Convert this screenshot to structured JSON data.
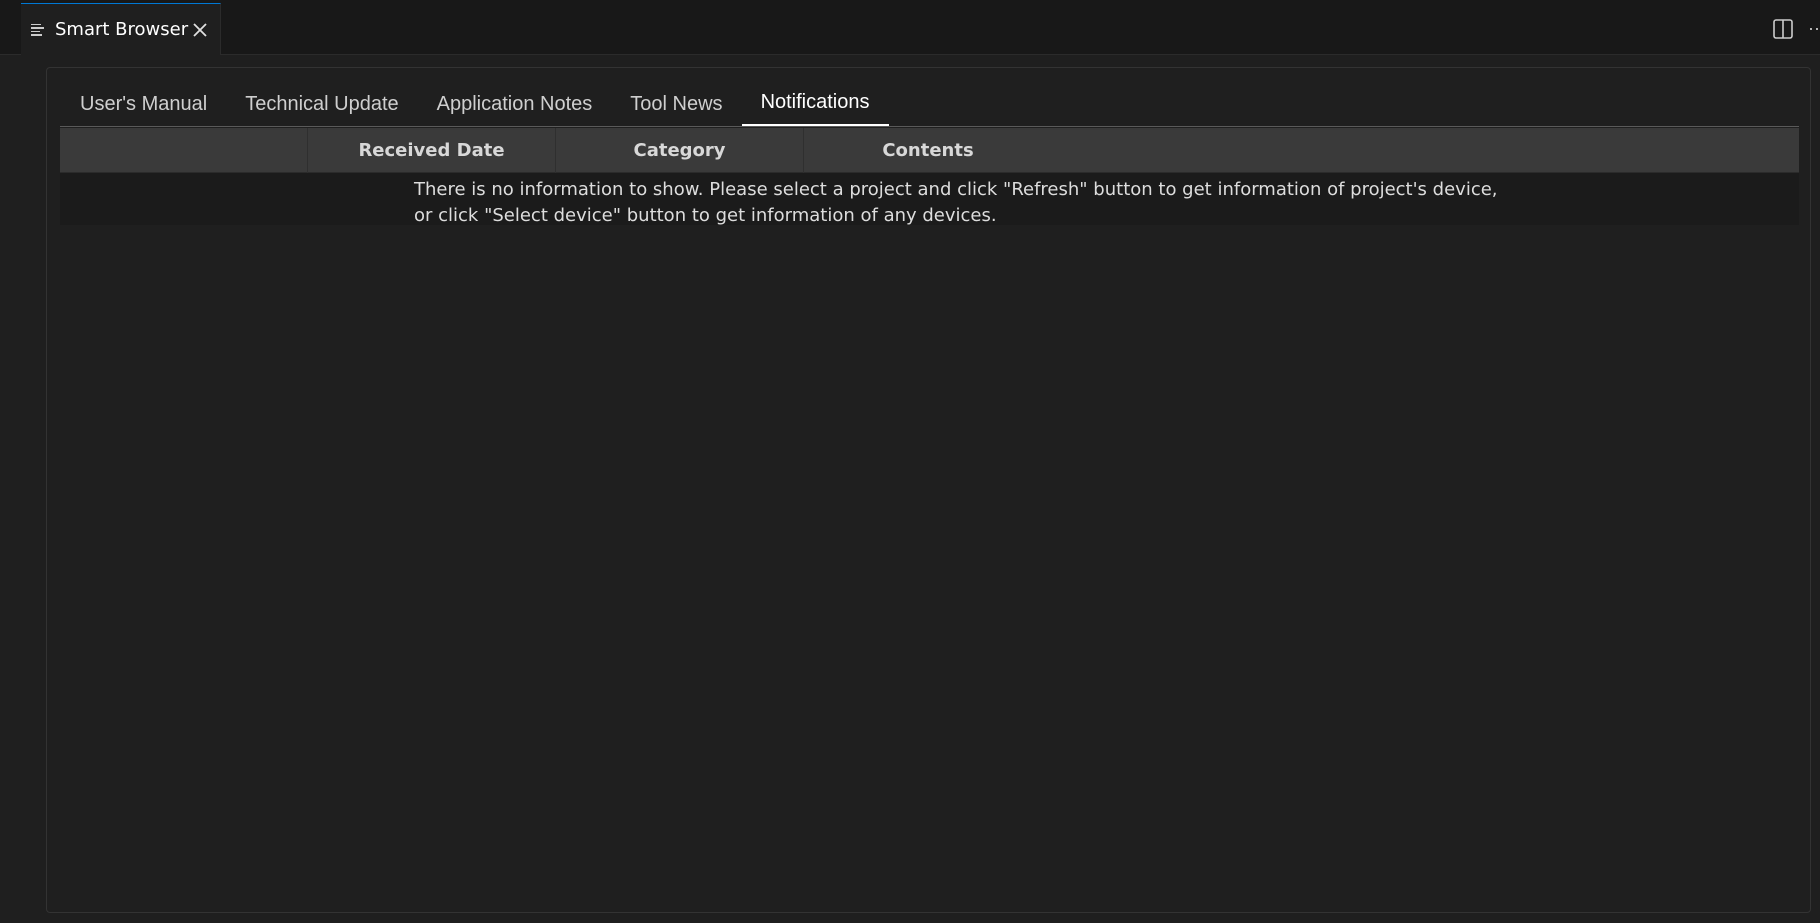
{
  "editor_tab": {
    "title": "Smart Browser",
    "icon": "list-icon",
    "close_icon": "close-icon"
  },
  "toolbar": {
    "split_icon": "split-editor-icon",
    "more_icon": "more-actions-icon"
  },
  "nav_tabs": [
    {
      "label": "User's Manual",
      "active": false
    },
    {
      "label": "Technical Update",
      "active": false
    },
    {
      "label": "Application Notes",
      "active": false
    },
    {
      "label": "Tool News",
      "active": false
    },
    {
      "label": "Notifications",
      "active": true
    }
  ],
  "table": {
    "columns": [
      "",
      "Received Date",
      "Category",
      "Contents"
    ],
    "empty_message": [
      "There is no information to show. Please select a project and click \"Refresh\" button to get information of project's device,",
      "or click \"Select device\" button to get information of any devices."
    ]
  },
  "colors": {
    "accent": "#0078d4",
    "background": "#1f1f1f",
    "header": "#3a3a3a"
  }
}
